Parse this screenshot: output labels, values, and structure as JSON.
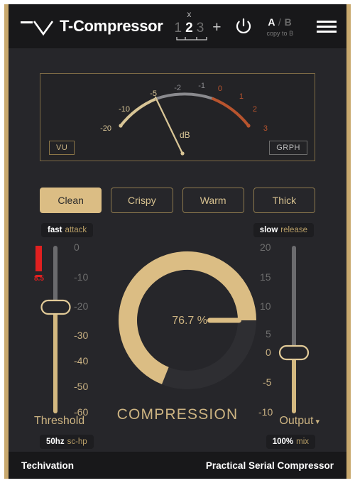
{
  "frame": {
    "accent_color": "#c9a96e",
    "background": "#26262a",
    "panel_bg": "#18181a"
  },
  "header": {
    "logo_icon": "techivation-v-logo-icon",
    "title": "T-Compressor",
    "preset_slots": {
      "marker": "x",
      "items": [
        "1",
        "2",
        "3"
      ],
      "active_index": 1
    },
    "add_label": "+",
    "power_icon": "power-icon",
    "ab": {
      "a": "A",
      "separator": "/",
      "b": "B",
      "copy_label": "copy to B"
    },
    "menu_icon": "hamburger-menu-icon"
  },
  "meter": {
    "view_vu_label": "VU",
    "view_graph_label": "GRPH",
    "active_view": "VU",
    "unit_label": "dB",
    "needle_value": -5,
    "ticks": [
      "-20",
      "-10",
      "-5",
      "-2",
      "-1",
      "0",
      "1",
      "2",
      "3"
    ],
    "zone_low_color": "#d8c596",
    "zone_mid_color": "#8a8a8e",
    "zone_high_color": "#b8542e"
  },
  "presets": {
    "items": [
      "Clean",
      "Crispy",
      "Warm",
      "Thick"
    ],
    "active_index": 0
  },
  "attack": {
    "value": "fast",
    "label": "attack"
  },
  "release": {
    "value": "slow",
    "label": "release"
  },
  "threshold": {
    "title": "Threshold",
    "ticks": [
      "0",
      "-10",
      "-20",
      "-30",
      "-40",
      "-50",
      "-60"
    ],
    "handle_value": "-20",
    "gain_reduction": "8.5",
    "gr_color": "#e02020"
  },
  "sidechain": {
    "value": "50hz",
    "label": "sc-hp"
  },
  "compression": {
    "value": "76.7 %",
    "label": "COMPRESSION",
    "percent": 76.7
  },
  "output": {
    "title": "Output",
    "caret": "▾",
    "ticks": [
      "20",
      "15",
      "10",
      "5",
      "0",
      "-5",
      "-10"
    ],
    "handle_value": "0"
  },
  "mix": {
    "value": "100%",
    "label": "mix"
  },
  "footer": {
    "brand": "Techivation",
    "tagline": "Practical Serial Compressor"
  }
}
